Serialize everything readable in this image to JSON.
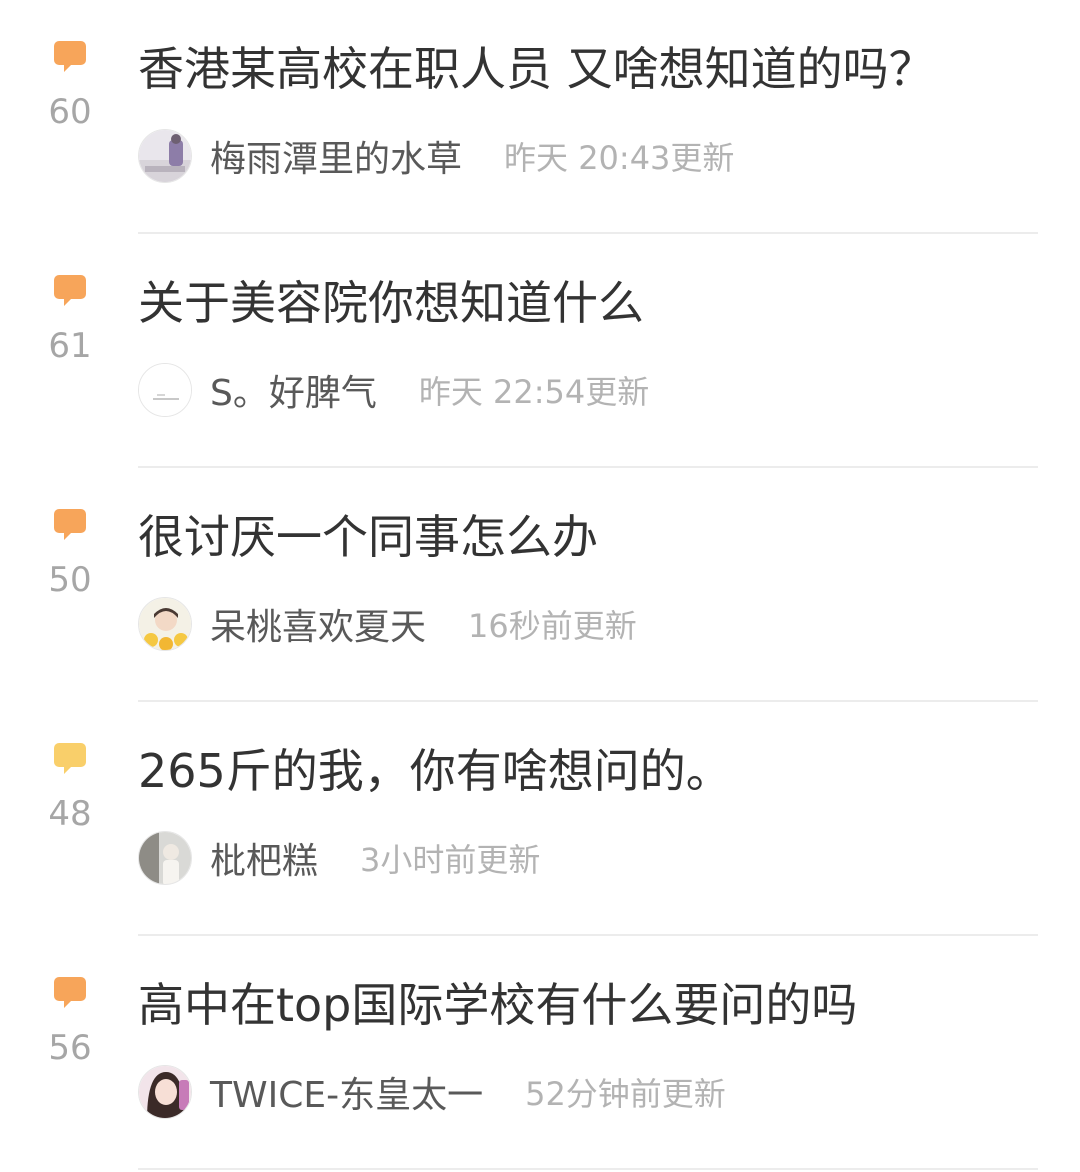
{
  "colors": {
    "bubble_orange": "#f7a55a",
    "bubble_yellow": "#f9cf6a",
    "count_text": "#a6a6a6",
    "title_text": "#333333",
    "meta_text": "#b3b3b3",
    "divider": "#ececec"
  },
  "posts": [
    {
      "reply_count": "60",
      "title": "香港某高校在职人员 又啥想知道的吗？",
      "author": "梅雨潭里的水草",
      "updated": "昨天 20:43更新",
      "bubble_icon": "comment-bubble-icon"
    },
    {
      "reply_count": "61",
      "title": "关于美容院你想知道什么",
      "author": "S。好脾气",
      "updated": "昨天 22:54更新",
      "bubble_icon": "comment-bubble-icon"
    },
    {
      "reply_count": "50",
      "title": "很讨厌一个同事怎么办",
      "author": "呆桃喜欢夏天",
      "updated": "16秒前更新",
      "bubble_icon": "comment-bubble-icon"
    },
    {
      "reply_count": "48",
      "title": "265斤的我，你有啥想问的。",
      "author": "枇杷糕",
      "updated": "3小时前更新",
      "bubble_icon": "comment-bubble-icon"
    },
    {
      "reply_count": "56",
      "title": "高中在top国际学校有什么要问的吗",
      "author": "TWICE-东皇太一",
      "updated": "52分钟前更新",
      "bubble_icon": "comment-bubble-icon"
    }
  ]
}
